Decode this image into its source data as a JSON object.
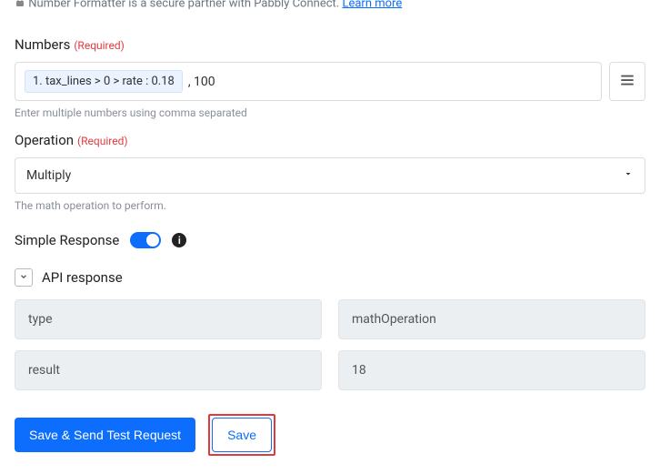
{
  "info": {
    "text_prefix": "Number Formatter is a secure partner with Pabbly Connect.",
    "learn_more": "Learn more"
  },
  "numbers": {
    "label": "Numbers",
    "required": "(Required)",
    "chip": "1. tax_lines > 0 > rate : 0.18",
    "trailing": " , 100",
    "helper": "Enter multiple numbers using comma separated"
  },
  "operation": {
    "label": "Operation",
    "required": "(Required)",
    "value": "Multiply",
    "helper": "The math operation to perform."
  },
  "simple": {
    "label": "Simple Response",
    "info_char": "i"
  },
  "api": {
    "header": "API response",
    "rows": [
      {
        "key": "type",
        "value": "mathOperation"
      },
      {
        "key": "result",
        "value": "18"
      }
    ]
  },
  "actions": {
    "primary": "Save & Send Test Request",
    "save": "Save"
  }
}
